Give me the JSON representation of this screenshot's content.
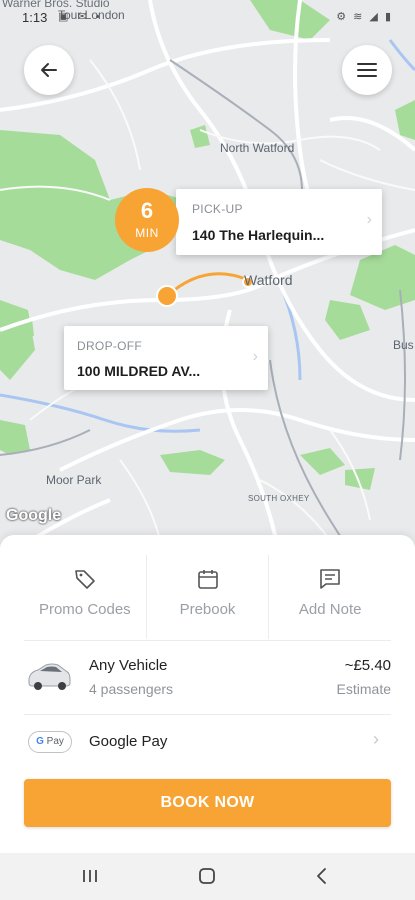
{
  "status_bar": {
    "time": "1:13",
    "left_icons": "▣ ✉ •",
    "right_icons": "⚙ ≋ ◢ ▮"
  },
  "map": {
    "top_cut_label": "Warner Bros. Studio",
    "labels": {
      "tour_london": "Tour London",
      "north_watford": "North Watford",
      "watford": "Watford",
      "bus": "Bus",
      "moor_park": "Moor Park",
      "south_oxhey": "SOUTH OXHEY"
    },
    "attribution": "Google",
    "colors": {
      "route": "#f8a434",
      "park": "#a6dc9a",
      "water": "#a9c6f2",
      "road": "#ffffff"
    }
  },
  "eta": {
    "value": "6",
    "unit": "MIN"
  },
  "pickup": {
    "label": "PICK-UP",
    "address": "140 The Harlequin..."
  },
  "dropoff": {
    "label": "DROP-OFF",
    "address": "100 MILDRED AV..."
  },
  "options": [
    {
      "label": "Promo Codes",
      "icon": "tag-icon"
    },
    {
      "label": "Prebook",
      "icon": "calendar-icon"
    },
    {
      "label": "Add Note",
      "icon": "note-icon"
    }
  ],
  "vehicle": {
    "name": "Any Vehicle",
    "passengers": "4 passengers",
    "price": "~£5.40",
    "price_note": "Estimate"
  },
  "payment": {
    "badge_g": "G",
    "badge_text": "Pay",
    "label": "Google Pay"
  },
  "book_button": "BOOK NOW",
  "accent_color": "#f8a434"
}
